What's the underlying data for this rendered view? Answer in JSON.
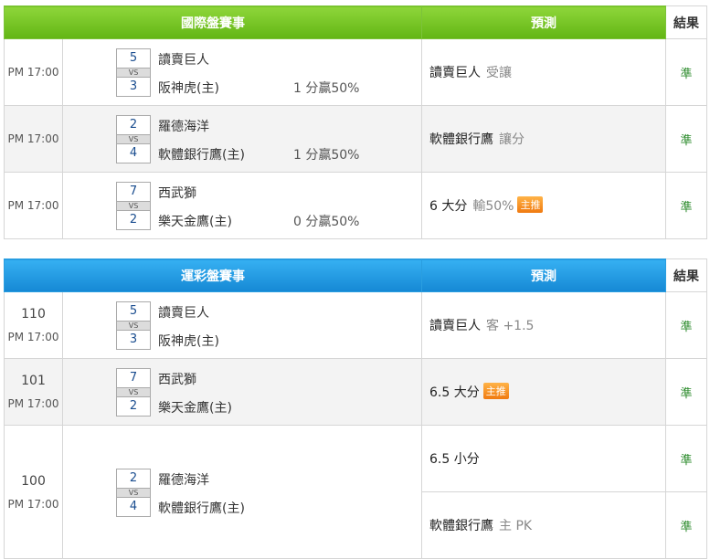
{
  "intl": {
    "header": "國際盤賽事",
    "pred_header": "預測",
    "result_header": "結果",
    "rows": [
      {
        "time": "PM 17:00",
        "away_score": "5",
        "home_score": "3",
        "vs": "VS",
        "away": "讀賣巨人",
        "home": "阪神虎(主)",
        "odds": "1 分贏50%",
        "pred": "讀賣巨人",
        "pred_sub": "受讓",
        "badge": "",
        "result": "準"
      },
      {
        "time": "PM 17:00",
        "away_score": "2",
        "home_score": "4",
        "vs": "VS",
        "away": "羅德海洋",
        "home": "軟體銀行鷹(主)",
        "odds": "1 分贏50%",
        "pred": "軟體銀行鷹",
        "pred_sub": "讓分",
        "badge": "",
        "result": "準"
      },
      {
        "time": "PM 17:00",
        "away_score": "7",
        "home_score": "2",
        "vs": "VS",
        "away": "西武獅",
        "home": "樂天金鷹(主)",
        "odds": "0 分贏50%",
        "pred": "6 大分",
        "pred_sub": "輸50%",
        "badge": "主推",
        "result": "準"
      }
    ]
  },
  "lottery": {
    "header": "運彩盤賽事",
    "pred_header": "預測",
    "result_header": "結果",
    "rows": [
      {
        "code": "110",
        "time": "PM 17:00",
        "away_score": "5",
        "home_score": "3",
        "vs": "VS",
        "away": "讀賣巨人",
        "home": "阪神虎(主)",
        "pred": "讀賣巨人",
        "pred_sub": "客 +1.5",
        "badge": "",
        "result": "準"
      },
      {
        "code": "101",
        "time": "PM 17:00",
        "away_score": "7",
        "home_score": "2",
        "vs": "VS",
        "away": "西武獅",
        "home": "樂天金鷹(主)",
        "pred": "6.5 大分",
        "pred_sub": "",
        "badge": "主推",
        "result": "準"
      },
      {
        "code": "100",
        "time": "PM 17:00",
        "away_score": "2",
        "home_score": "4",
        "vs": "VS",
        "away": "羅德海洋",
        "home": "軟體銀行鷹(主)",
        "preds": [
          {
            "pred": "6.5 小分",
            "pred_sub": "",
            "result": "準"
          },
          {
            "pred": "軟體銀行鷹",
            "pred_sub": "主 PK",
            "result": "準"
          }
        ]
      }
    ]
  }
}
